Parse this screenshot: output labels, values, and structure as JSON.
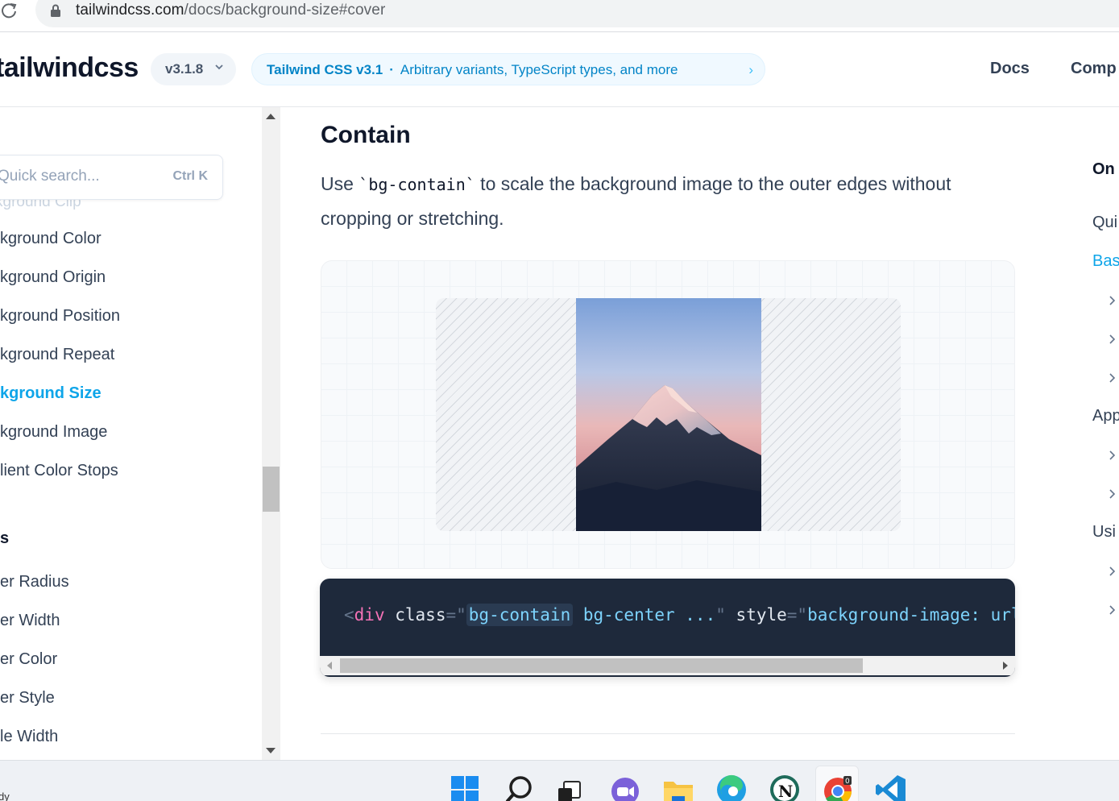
{
  "browser": {
    "url_host": "tailwindcss.com",
    "url_path": "/docs/background-size#cover"
  },
  "header": {
    "logo": "tailwindcss",
    "version": "v3.1.8",
    "announcement_title": "Tailwind CSS v3.1",
    "announcement_sep": "·",
    "announcement_text": "Arbitrary variants, TypeScript types, and more",
    "announcement_arrow": "›",
    "nav": [
      "Docs",
      "Comp"
    ]
  },
  "sidebar": {
    "search_placeholder": "Quick search...",
    "search_shortcut": "Ctrl K",
    "faded_item": "kground Clip",
    "items": [
      "kground Color",
      "kground Origin",
      "kground Position",
      "kground Repeat",
      "kground Size",
      "kground Image",
      "lient Color Stops"
    ],
    "active_index": 4,
    "section_heading": "s",
    "section_items": [
      "er Radius",
      "er Width",
      "er Color",
      "er Style",
      "le Width"
    ]
  },
  "main": {
    "title": "Contain",
    "desc_before": "Use ",
    "desc_code": "`bg-contain`",
    "desc_after": " to scale the background image to the outer edges without cropping or stretching.",
    "code": {
      "open": "<",
      "tag": "div",
      "attr1": "class",
      "eq": "=",
      "q": "\"",
      "cls_hl": "bg-contain",
      "cls_rest": " bg-center ...",
      "attr2": "style",
      "val2": "background-image: url"
    }
  },
  "toc": {
    "heading": "On",
    "items": [
      {
        "label": "Qui",
        "active": false
      },
      {
        "label": "Bas",
        "active": true
      },
      {
        "label": "App",
        "active": false
      },
      {
        "label": "Usi",
        "active": false
      }
    ]
  },
  "taskbar": {
    "status_text": "dy",
    "apps": [
      "windows-start",
      "search",
      "task-view",
      "teams-chat",
      "file-explorer",
      "edge",
      "notion",
      "chrome",
      "vscode"
    ]
  },
  "colors": {
    "accent": "#0ea5e9",
    "code_bg": "#1e293b",
    "text": "#0f172a"
  }
}
